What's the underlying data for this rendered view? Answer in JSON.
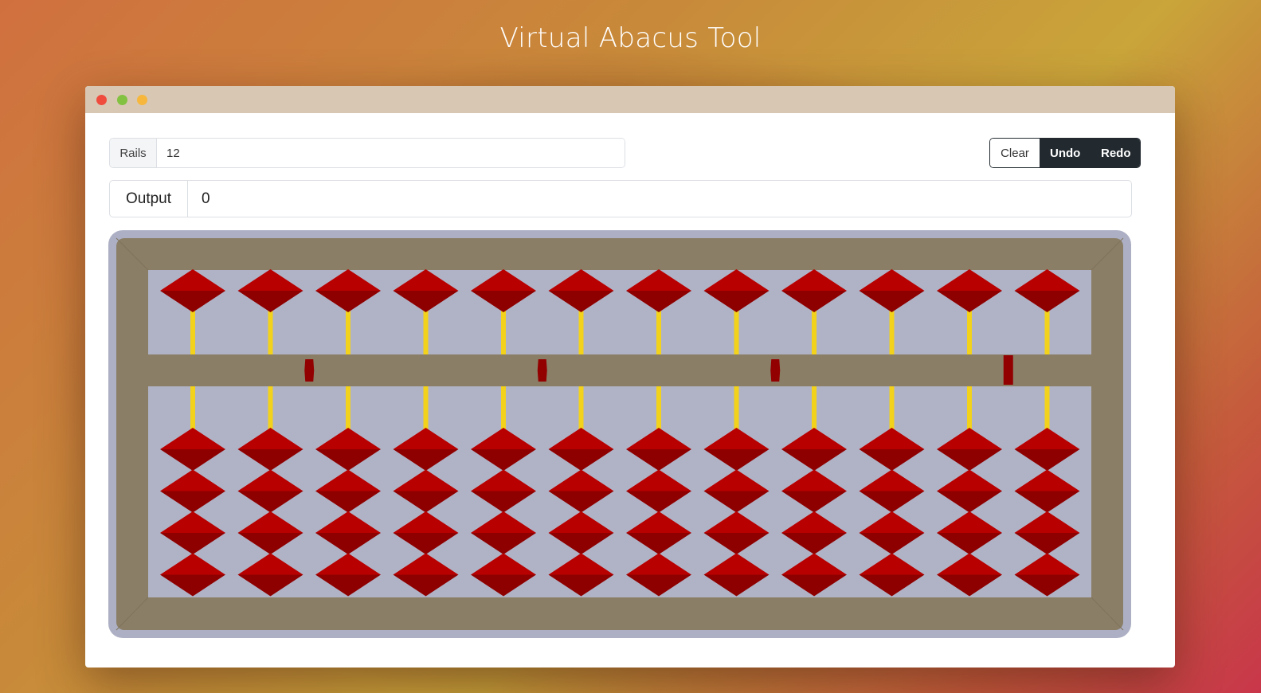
{
  "page": {
    "title": "Virtual Abacus Tool"
  },
  "window": {
    "controls": [
      "close",
      "minimize",
      "maximize"
    ]
  },
  "controls": {
    "rails_label": "Rails",
    "rails_value": "12",
    "clear_label": "Clear",
    "undo_label": "Undo",
    "redo_label": "Redo"
  },
  "output": {
    "label": "Output",
    "value": "0"
  },
  "abacus": {
    "rails": 12,
    "upper_beads_per_rail": 1,
    "lower_beads_per_rail": 4,
    "upper_active": [
      0,
      0,
      0,
      0,
      0,
      0,
      0,
      0,
      0,
      0,
      0,
      0
    ],
    "lower_active": [
      0,
      0,
      0,
      0,
      0,
      0,
      0,
      0,
      0,
      0,
      0,
      0
    ],
    "colors": {
      "frame": "#8a7e66",
      "frame_border": "#adb0c4",
      "board": "#b0b3c6",
      "bead_top": "#b80000",
      "bead_bottom": "#8e0000",
      "rod": "#f2d21a",
      "marker": "#930000"
    }
  }
}
